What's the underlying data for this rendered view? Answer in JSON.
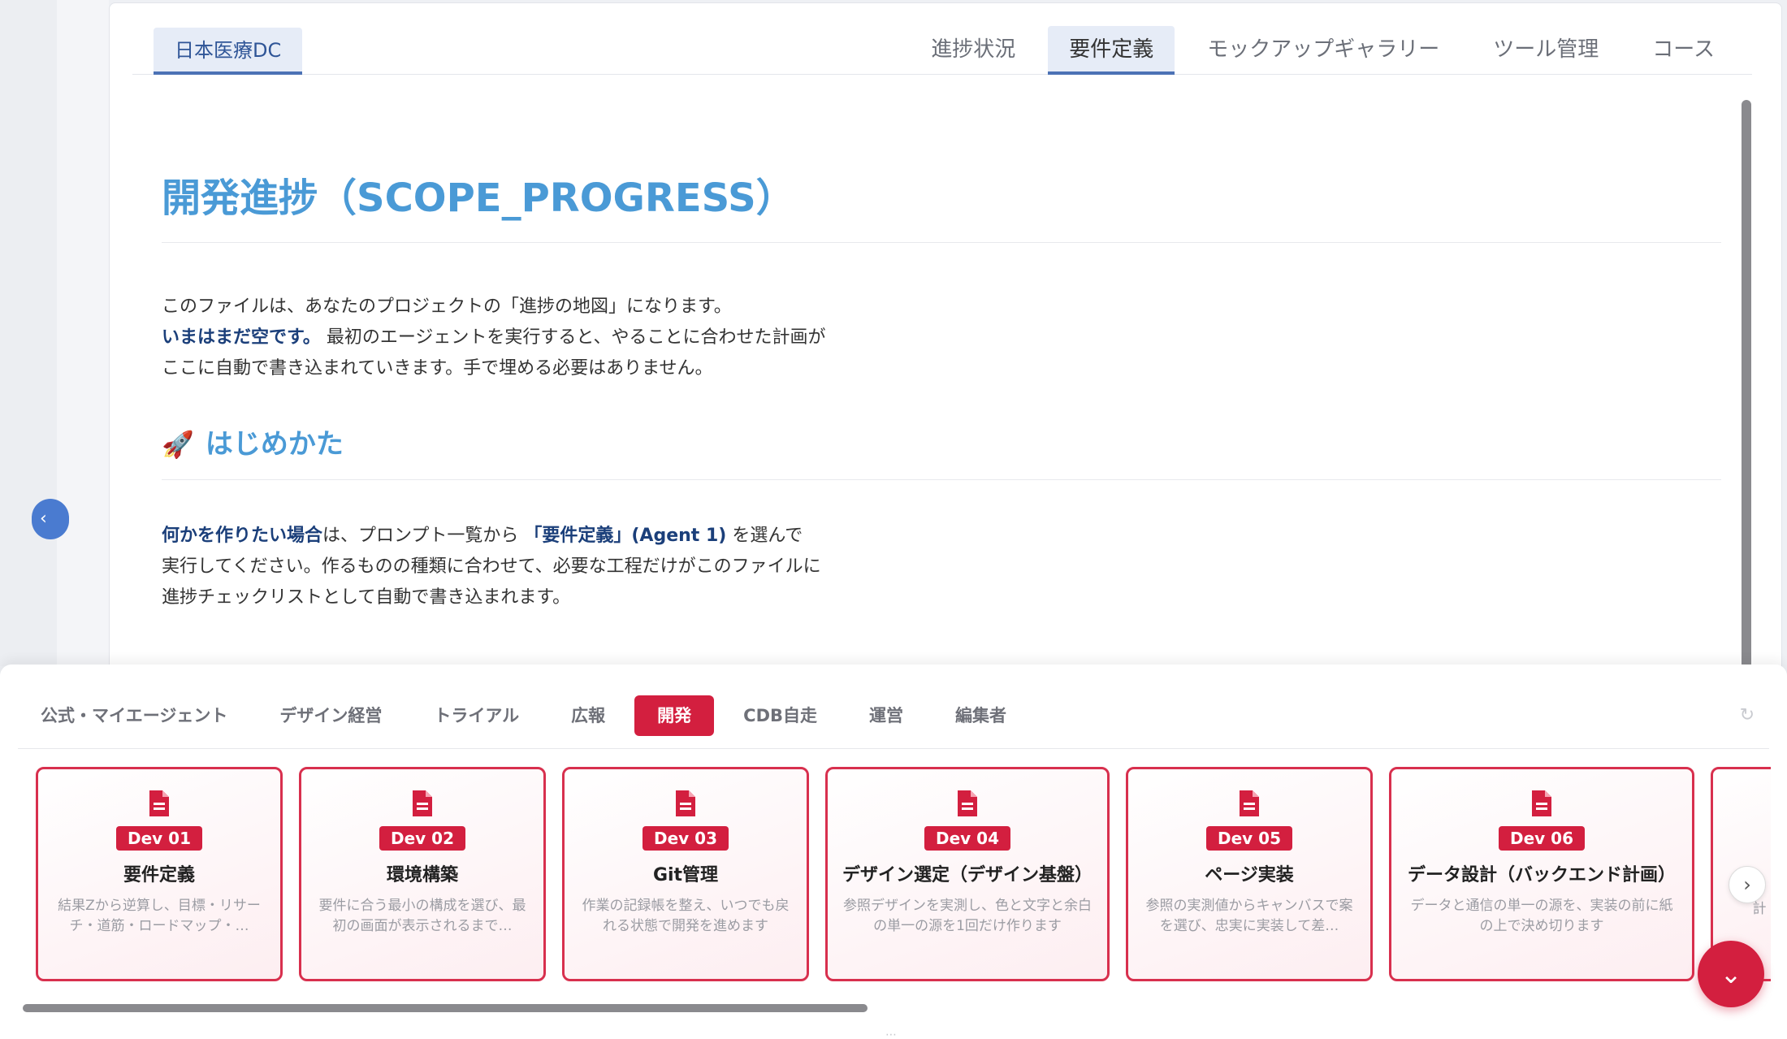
{
  "brand": "日本医療DC",
  "nav": {
    "tabs": [
      {
        "label": "進捗状況",
        "active": false
      },
      {
        "label": "要件定義",
        "active": true
      },
      {
        "label": "モックアップギャラリー",
        "active": false
      },
      {
        "label": "ツール管理",
        "active": false
      },
      {
        "label": "コース",
        "active": false
      }
    ]
  },
  "doc": {
    "title": "開発進捗（SCOPE_PROGRESS）",
    "intro_line1": "このファイルは、あなたのプロジェクトの「進捗の地図」になります。",
    "intro_strong": "いまはまだ空です。",
    "intro_line2": "最初のエージェントを実行すると、やることに合わせた計画が",
    "intro_line3": "ここに自動で書き込まれていきます。手で埋める必要はありません。",
    "section_icon": "rocket-emoji",
    "section_title": "はじめかた",
    "how_strong": "何かを作りたい場合",
    "how_text1": "は、プロンプト一覧から",
    "how_agent": "「要件定義」(Agent 1)",
    "how_text2": "を選んで",
    "how_line2": "実行してください。作るものの種類に合わせて、必要な工程だけがこのファイルに",
    "how_line3": "進捗チェックリストとして自動で書き込まれます。"
  },
  "categories": [
    {
      "label": "公式・マイエージェント",
      "active": false
    },
    {
      "label": "デザイン経営",
      "active": false
    },
    {
      "label": "トライアル",
      "active": false
    },
    {
      "label": "広報",
      "active": false
    },
    {
      "label": "開発",
      "active": true
    },
    {
      "label": "CDB自走",
      "active": false
    },
    {
      "label": "運営",
      "active": false
    },
    {
      "label": "編集者",
      "active": false
    }
  ],
  "cards": [
    {
      "code": "Dev 01",
      "title": "要件定義",
      "desc": "結果Zから逆算し、目標・リサーチ・道筋・ロードマップ・…",
      "icon": "document-icon"
    },
    {
      "code": "Dev 02",
      "title": "環境構築",
      "desc": "要件に合う最小の構成を選び、最初の画面が表示されるまで…",
      "icon": "document-icon"
    },
    {
      "code": "Dev 03",
      "title": "Git管理",
      "desc": "作業の記録帳を整え、いつでも戻れる状態で開発を進めます",
      "icon": "document-icon"
    },
    {
      "code": "Dev 04",
      "title": "デザイン選定（デザイン基盤）",
      "desc": "参照デザインを実測し、色と文字と余白の単一の源を1回だけ作ります",
      "icon": "document-icon"
    },
    {
      "code": "Dev 05",
      "title": "ページ実装",
      "desc": "参照の実測値からキャンバスで案を選び、忠実に実装して差…",
      "icon": "document-icon"
    },
    {
      "code": "Dev 06",
      "title": "データ設計（バックエンド計画）",
      "desc": "データと通信の単一の源を、実装の前に紙の上で決め切ります",
      "icon": "document-icon"
    },
    {
      "code": "",
      "title": "",
      "desc": "計",
      "icon": "document-icon"
    }
  ],
  "colors": {
    "accent": "#d31f3f",
    "heading": "#4a9ad6",
    "brand": "#4c72b5"
  }
}
